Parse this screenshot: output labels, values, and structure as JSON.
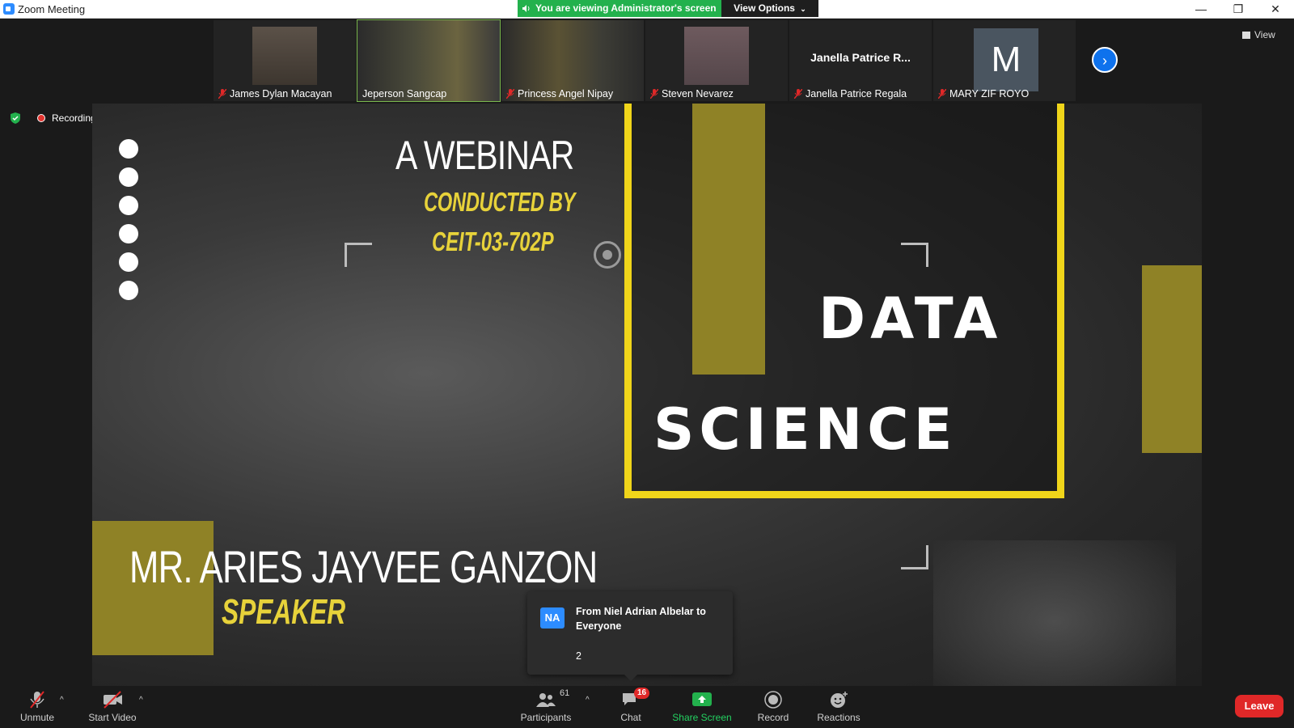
{
  "window": {
    "title": "Zoom Meeting",
    "controls": {
      "minimize": "—",
      "restore": "❐",
      "close": "✕"
    }
  },
  "banner": {
    "viewing_text": "You are viewing Administrator's screen",
    "view_options_label": "View Options"
  },
  "participants_strip": {
    "thumbnails": [
      {
        "name": "James Dylan Macayan",
        "muted": true,
        "video": true
      },
      {
        "name": "Jeperson Sangcap",
        "muted": false,
        "video": true,
        "active_speaker": true
      },
      {
        "name": "Princess Angel Nipay",
        "muted": true,
        "video": true
      },
      {
        "name": "Steven Nevarez",
        "muted": true,
        "video": true
      },
      {
        "name": "Janella Patrice Regala",
        "display_name": "Janella Patrice R...",
        "muted": true,
        "video": false
      },
      {
        "name": "MARY ZIF ROYO",
        "avatar_letter": "M",
        "muted": true,
        "video": false
      }
    ],
    "next_icon": "chevron-right-icon",
    "view_label": "View"
  },
  "status": {
    "recording_label": "Recording"
  },
  "shared_content": {
    "title": "A WEBINAR",
    "conducted_by": "CONDUCTED BY",
    "organizer": "CEIT-03-702P",
    "topic_line1": "DATA",
    "topic_line2": "SCIENCE",
    "speaker_name": "MR. ARIES JAYVEE GANZON",
    "speaker_role": "SPEAKER",
    "accent_color": "#f0d51a",
    "olive_color": "#8f8226"
  },
  "chat_popup": {
    "initials": "NA",
    "from": "From Niel Adrian Albelar to Everyone",
    "message": "2"
  },
  "toolbar": {
    "unmute": "Unmute",
    "start_video": "Start Video",
    "participants": "Participants",
    "participants_count": "61",
    "chat": "Chat",
    "chat_badge": "16",
    "share_screen": "Share Screen",
    "record": "Record",
    "reactions": "Reactions",
    "leave": "Leave"
  }
}
